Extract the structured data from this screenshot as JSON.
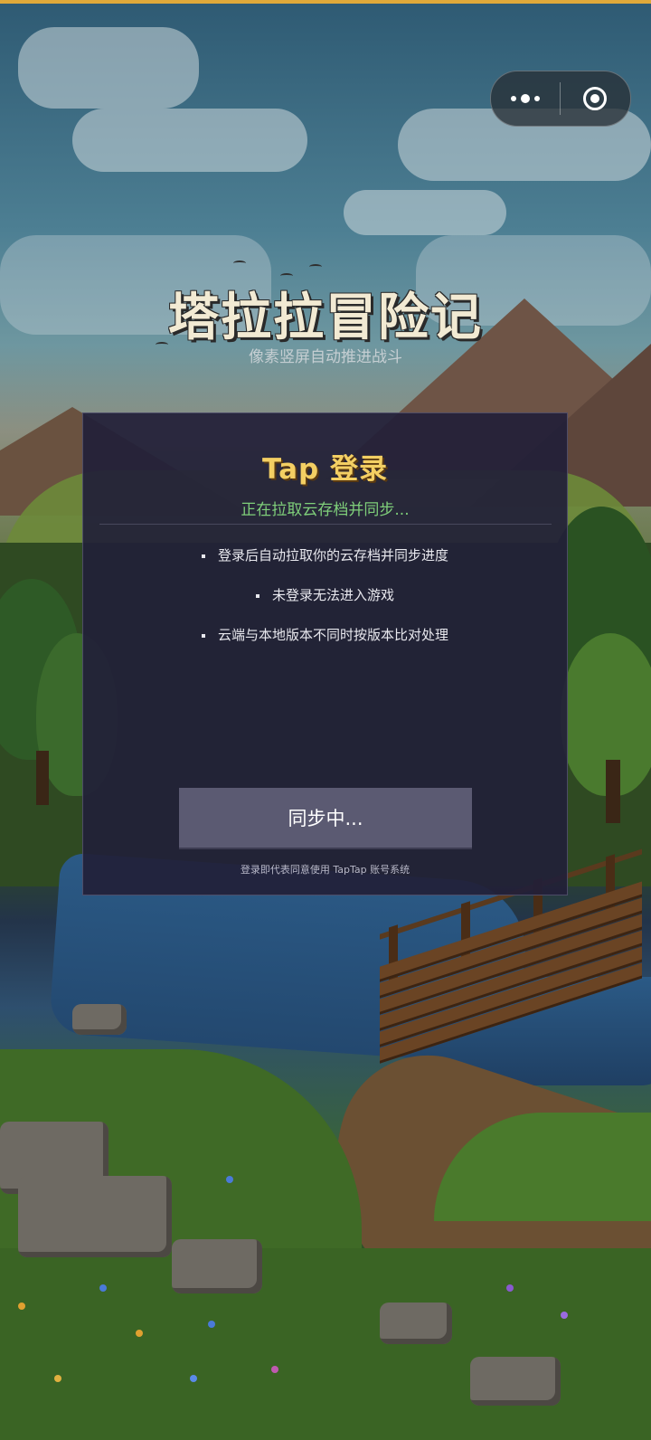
{
  "game": {
    "title": "塔拉拉冒险记",
    "subtitle": "像素竖屏自动推进战斗"
  },
  "capsule": {
    "more_icon": "more-dots-icon",
    "close_icon": "target-circle-icon"
  },
  "login_panel": {
    "title": "Tap 登录",
    "status": "正在拉取云存档并同步...",
    "tips": [
      "登录后自动拉取你的云存档并同步进度",
      "未登录无法进入游戏",
      "云端与本地版本不同时按版本比对处理"
    ],
    "button_label": "同步中...",
    "note": "登录即代表同意使用 TapTap 账号系统"
  },
  "colors": {
    "accent_gold": "#f3cf63",
    "status_green": "#7fcf7a",
    "panel_bg": "#222038",
    "button_bg": "#5b5a72",
    "top_bar": "#e0a93a"
  }
}
